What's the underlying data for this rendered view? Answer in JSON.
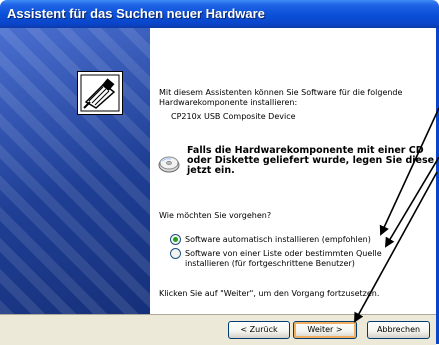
{
  "window": {
    "title": "Assistent für das Suchen neuer Hardware"
  },
  "content": {
    "intro_line1": "Mit diesem Assistenten können Sie Software für die folgende",
    "intro_line2": "Hardwarekomponente installieren:",
    "device_name": "CP210x USB Composite Device",
    "cd_hint_line1": "Falls die Hardwarekomponente mit einer CD",
    "cd_hint_line2": "oder Diskette geliefert wurde, legen Sie diese",
    "cd_hint_line3": "jetzt ein.",
    "question": "Wie möchten Sie vorgehen?",
    "options": [
      {
        "label": "Software automatisch installieren (empfohlen)",
        "selected": true
      },
      {
        "label_line1": "Software von einer Liste oder bestimmten Quelle",
        "label_line2": "installieren (für fortgeschrittene Benutzer)",
        "selected": false
      }
    ],
    "footer_hint": "Klicken Sie auf \"Weiter\", um den Vorgang fortzusetzen."
  },
  "buttons": {
    "back": "< Zurück",
    "next": "Weiter >",
    "cancel": "Abbrechen"
  },
  "icons": [
    "hardware-icon",
    "cd-icon",
    "radio-selected",
    "radio-unselected"
  ],
  "colors": {
    "titlebar": "#0a4fd8",
    "sidepanel": "#1f3f95",
    "bottombar": "#ece9d8",
    "radio_dot": "#21a121",
    "arrows": "#000000"
  }
}
